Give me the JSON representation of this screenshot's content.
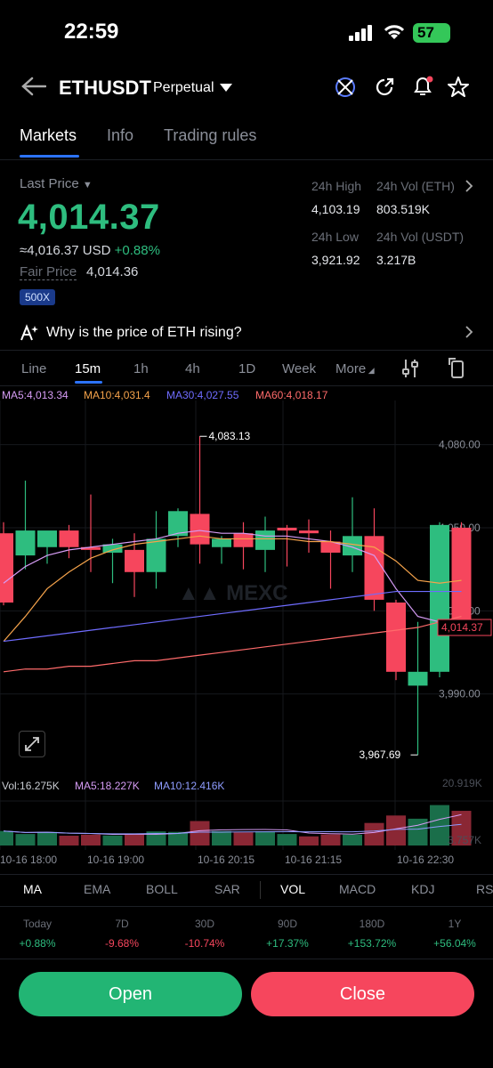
{
  "status": {
    "time": "22:59",
    "battery": "57"
  },
  "header": {
    "pair": "ETHUSDT",
    "contract": "Perpetual"
  },
  "tabs": [
    "Markets",
    "Info",
    "Trading rules"
  ],
  "price": {
    "label": "Last Price",
    "last": "4,014.37",
    "approx": "≈4,016.37",
    "currency": "USD",
    "change": "+0.88%",
    "fair_label": "Fair Price",
    "fair": "4,014.36",
    "leverage": "500X"
  },
  "stats": {
    "high_label": "24h High",
    "high": "4,103.19",
    "vol_eth_label": "24h Vol (ETH)",
    "vol_eth": "803.519K",
    "low_label": "24h Low",
    "low": "3,921.92",
    "vol_usdt_label": "24h Vol  (USDT)",
    "vol_usdt": "3.217B"
  },
  "why_text": "Why is the price of ETH rising?",
  "intervals": [
    "Line",
    "15m",
    "1h",
    "4h",
    "1D",
    "Week",
    "More"
  ],
  "ma_legend": {
    "ma5": "MA5:4,013.34",
    "ma10": "MA10:4,031.4",
    "ma30": "MA30:4,027.55",
    "ma60": "MA60:4,018.17"
  },
  "chart_data": {
    "type": "candlestick",
    "price_ticks": [
      4080,
      4050,
      4020,
      3990
    ],
    "price_tick_labels": [
      "4,080.00",
      "4,050.00",
      "4,020.00",
      "3,990.00"
    ],
    "ylim": [
      3961,
      4094
    ],
    "current_price_label": "4,014.37",
    "high_marker": "4,083.13",
    "low_marker": "3,967.69",
    "candles": [
      {
        "o": 4048,
        "h": 4052,
        "l": 4022,
        "c": 4023
      },
      {
        "o": 4040,
        "h": 4067,
        "l": 4035,
        "c": 4049
      },
      {
        "o": 4043,
        "h": 4046,
        "l": 4037,
        "c": 4049
      },
      {
        "o": 4049,
        "h": 4051,
        "l": 4039,
        "c": 4043
      },
      {
        "o": 4043,
        "h": 4062,
        "l": 4034,
        "c": 4042
      },
      {
        "o": 4041,
        "h": 4046,
        "l": 4030,
        "c": 4044
      },
      {
        "o": 4042,
        "h": 4048,
        "l": 4025,
        "c": 4034
      },
      {
        "o": 4034,
        "h": 4056,
        "l": 4028,
        "c": 4046
      },
      {
        "o": 4047,
        "h": 4057,
        "l": 4043,
        "c": 4056
      },
      {
        "o": 4055,
        "h": 4083,
        "l": 4037,
        "c": 4044
      },
      {
        "o": 4043,
        "h": 4047,
        "l": 4037,
        "c": 4046
      },
      {
        "o": 4048,
        "h": 4052,
        "l": 4035,
        "c": 4043
      },
      {
        "o": 4042,
        "h": 4054,
        "l": 4034,
        "c": 4049
      },
      {
        "o": 4050,
        "h": 4051,
        "l": 4036,
        "c": 4049
      },
      {
        "o": 4049,
        "h": 4053,
        "l": 4041,
        "c": 4048
      },
      {
        "o": 4045,
        "h": 4049,
        "l": 4028,
        "c": 4041
      },
      {
        "o": 4040,
        "h": 4061,
        "l": 4034,
        "c": 4047
      },
      {
        "o": 4047,
        "h": 4057,
        "l": 4020,
        "c": 4024
      },
      {
        "o": 4023,
        "h": 4024,
        "l": 3995,
        "c": 3998
      },
      {
        "o": 3993,
        "h": 4016,
        "l": 3968,
        "c": 3998
      },
      {
        "o": 3998,
        "h": 4052,
        "l": 3996,
        "c": 4051
      },
      {
        "o": 4050,
        "h": 4052,
        "l": 4012,
        "c": 4014
      }
    ],
    "ma_lines": [
      {
        "name": "MA5",
        "color": "#d69cf5",
        "values": [
          4030,
          4036,
          4040,
          4042,
          4043,
          4044,
          4045,
          4046,
          4048,
          4049,
          4048,
          4048,
          4047,
          4047,
          4046,
          4045,
          4043,
          4040,
          4028,
          4018,
          4016,
          4014
        ]
      },
      {
        "name": "MA10",
        "color": "#f5a34b",
        "values": [
          4009,
          4018,
          4028,
          4034,
          4039,
          4042,
          4044,
          4045,
          4046,
          4047,
          4046,
          4046,
          4046,
          4046,
          4045,
          4045,
          4044,
          4043,
          4038,
          4031,
          4030,
          4031
        ]
      },
      {
        "name": "MA30",
        "color": "#6f6cff",
        "values": [
          4009,
          4010,
          4011,
          4012,
          4013,
          4014,
          4015,
          4016,
          4017,
          4018,
          4019,
          4020,
          4021,
          4022,
          4023,
          4024,
          4025,
          4026,
          4027,
          4027,
          4027,
          4027
        ]
      },
      {
        "name": "MA60",
        "color": "#ff6b6b",
        "values": [
          3998,
          3999,
          3999,
          4000,
          4000,
          4001,
          4002,
          4002,
          4003,
          4004,
          4005,
          4006,
          4007,
          4008,
          4009,
          4010,
          4011,
          4012,
          4013,
          4014,
          4016,
          4018
        ]
      }
    ],
    "volume": {
      "legend": "Vol:16.275K",
      "ma5_label": "MA5:18.227K",
      "ma10_label": "MA10:12.416K",
      "ymax_label": "20.919K",
      "ymin_label": "3.757K",
      "values": [
        6.8,
        5.4,
        6.4,
        4.6,
        5.1,
        4.7,
        5.5,
        6.6,
        6.4,
        11.5,
        6.8,
        6.2,
        6.7,
        5.4,
        4.3,
        5.2,
        5.1,
        10.6,
        14.1,
        12.6,
        19.0,
        16.3
      ],
      "up": [
        true,
        true,
        true,
        false,
        false,
        true,
        false,
        true,
        true,
        false,
        true,
        false,
        true,
        true,
        false,
        false,
        true,
        false,
        false,
        true,
        true,
        false
      ]
    },
    "x_labels": [
      "10-16 18:00",
      "10-16 19:00",
      "10-16 20:15",
      "10-16 21:15",
      "10-16 22:30"
    ]
  },
  "indicators": [
    "MA",
    "EMA",
    "BOLL",
    "SAR",
    "VOL",
    "MACD",
    "KDJ",
    "RS"
  ],
  "performance": [
    {
      "label": "Today",
      "value": "+0.88%",
      "up": true
    },
    {
      "label": "7D",
      "value": "-9.68%",
      "up": false
    },
    {
      "label": "30D",
      "value": "-10.74%",
      "up": false
    },
    {
      "label": "90D",
      "value": "+17.37%",
      "up": true
    },
    {
      "label": "180D",
      "value": "+153.72%",
      "up": true
    },
    {
      "label": "1Y",
      "value": "+56.04%",
      "up": true
    }
  ],
  "buttons": {
    "open": "Open",
    "close": "Close"
  },
  "colors": {
    "up": "#2ebd7f",
    "down": "#f6465d",
    "accent": "#2c73ff"
  }
}
